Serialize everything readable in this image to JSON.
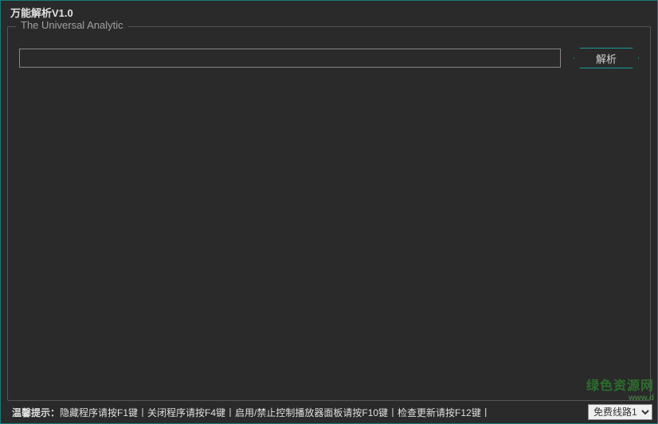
{
  "window": {
    "title": "万能解析V1.0"
  },
  "group": {
    "title": "The Universal Analytic"
  },
  "input": {
    "value": "",
    "placeholder": ""
  },
  "buttons": {
    "parse": "解析"
  },
  "status": {
    "prefix": "温馨提示：",
    "hints": "隐藏程序请按F1键丨关闭程序请按F4键丨启用/禁止控制播放器面板请按F10键丨检查更新请按F12键丨"
  },
  "dropdown": {
    "selected": "免费线路1"
  },
  "watermark": {
    "main": "绿色资源网",
    "sub": "www.d"
  }
}
